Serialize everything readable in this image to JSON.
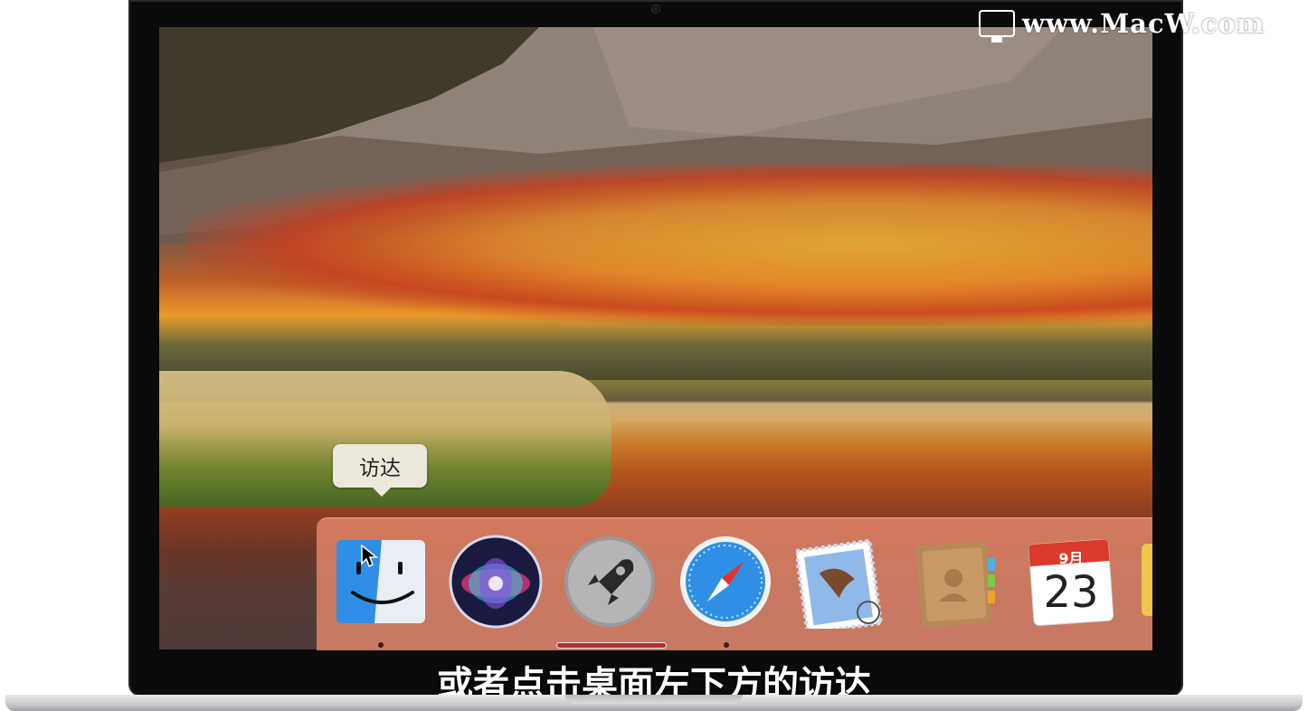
{
  "watermark": {
    "text": "www.MacW.com",
    "icon": "monitor-icon"
  },
  "tooltip": {
    "label": "访达"
  },
  "dock": {
    "items": [
      {
        "name": "Finder",
        "icon": "finder-icon",
        "running": true
      },
      {
        "name": "Siri",
        "icon": "siri-icon",
        "running": false
      },
      {
        "name": "Launchpad",
        "icon": "rocket-icon",
        "running": false
      },
      {
        "name": "Safari",
        "icon": "compass-icon",
        "running": true
      },
      {
        "name": "Mail",
        "icon": "stamp-eagle-icon",
        "running": false
      },
      {
        "name": "Contacts",
        "icon": "contacts-book-icon",
        "running": false
      },
      {
        "name": "Calendar",
        "icon": "calendar-icon",
        "running": false,
        "month": "9月",
        "day": "23"
      }
    ]
  },
  "subtitle": "或者点击桌面左下方的访达",
  "colors": {
    "dock_bg": "#e98c6e",
    "tooltip_bg": "#ece9dc",
    "calendar_red": "#d93a2b",
    "safari_blue": "#2f8fe6"
  }
}
